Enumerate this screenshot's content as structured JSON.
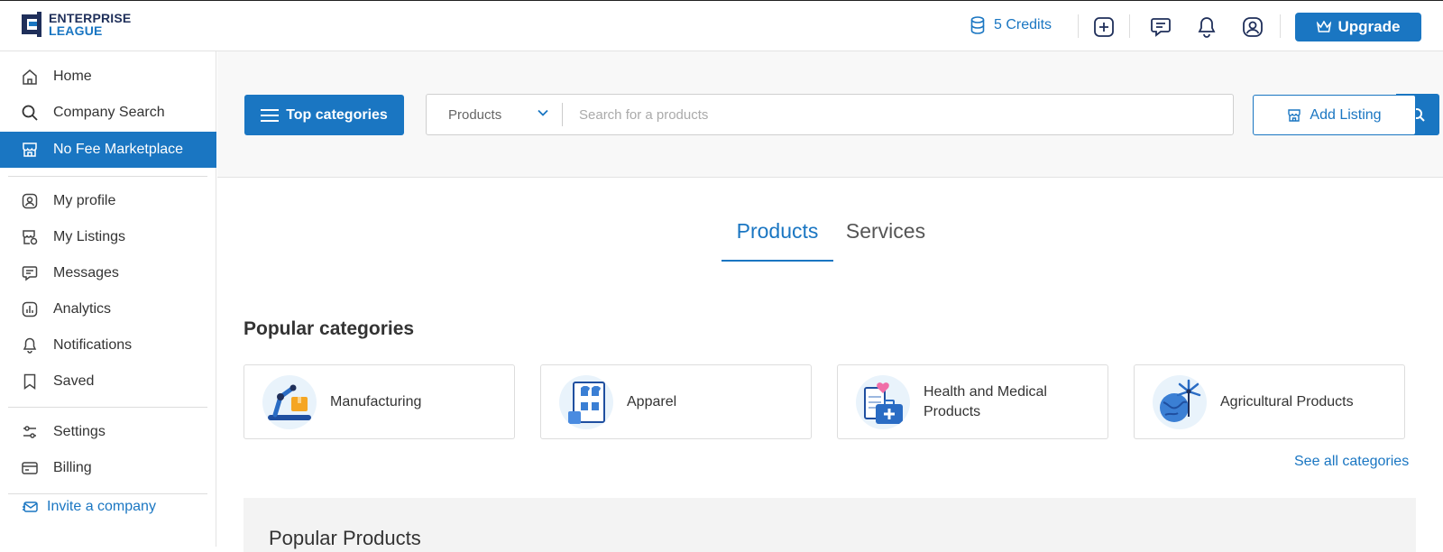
{
  "app": {
    "logo_line1": "ENTERPRISE",
    "logo_line2": "LEAGUE",
    "brand_color": "#1a76c2"
  },
  "topbar": {
    "credits_label": "5 Credits",
    "upgrade_label": "Upgrade",
    "icons": [
      "database-icon",
      "add-square-icon",
      "chat-icon",
      "bell-icon",
      "user-circle-icon",
      "crown-icon"
    ]
  },
  "sidebar": {
    "items": [
      {
        "label": "Home",
        "icon": "home-icon"
      },
      {
        "label": "Company Search",
        "icon": "search-icon"
      },
      {
        "label": "No Fee Marketplace",
        "icon": "store-icon",
        "active": true
      },
      {
        "label": "My profile",
        "icon": "profile-icon"
      },
      {
        "label": "My Listings",
        "icon": "listings-icon"
      },
      {
        "label": "Messages",
        "icon": "chat-icon"
      },
      {
        "label": "Analytics",
        "icon": "analytics-icon"
      },
      {
        "label": "Notifications",
        "icon": "bell-icon"
      },
      {
        "label": "Saved",
        "icon": "bookmark-icon"
      },
      {
        "label": "Settings",
        "icon": "sliders-icon"
      },
      {
        "label": "Billing",
        "icon": "card-icon"
      }
    ],
    "invite_label": "Invite a company"
  },
  "search": {
    "top_categories_label": "Top categories",
    "select_value": "Products",
    "placeholder": "Search for a products",
    "add_listing_label": "Add Listing"
  },
  "tabs": [
    {
      "label": "Products",
      "active": true
    },
    {
      "label": "Services",
      "active": false
    }
  ],
  "popular_categories": {
    "title": "Popular categories",
    "items": [
      {
        "label": "Manufacturing",
        "icon": "robot-arm-icon"
      },
      {
        "label": "Apparel",
        "icon": "apparel-icon"
      },
      {
        "label": "Health and Medical Products",
        "icon": "medical-kit-icon"
      },
      {
        "label": "Agricultural Products",
        "icon": "globe-windmill-icon"
      }
    ],
    "see_all_label": "See all categories"
  },
  "popular_products": {
    "title": "Popular Products"
  }
}
